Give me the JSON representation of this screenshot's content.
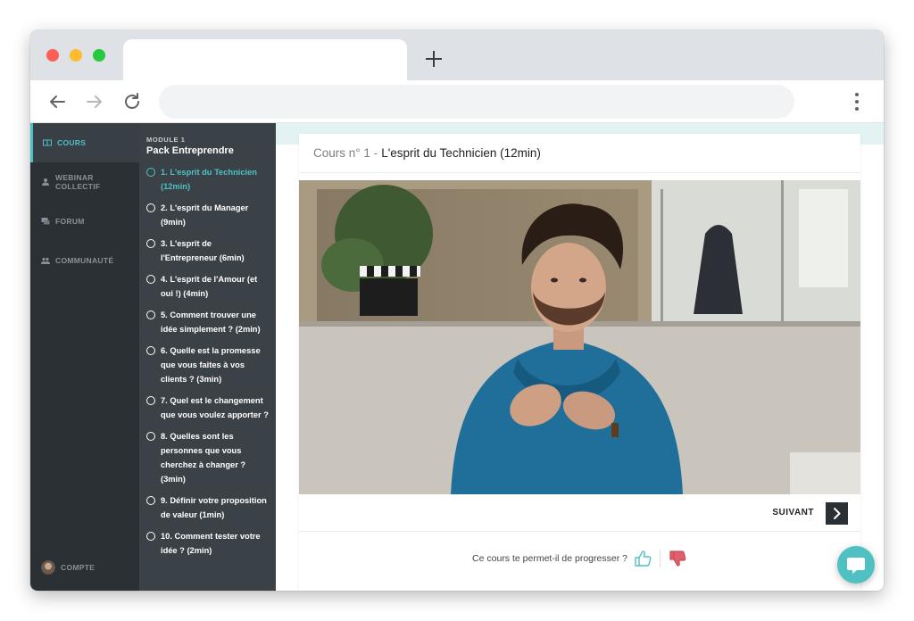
{
  "browser": {
    "tab_title": "",
    "address": ""
  },
  "sidebar": {
    "items": [
      {
        "label": "COURS",
        "icon": "book-icon",
        "active": true
      },
      {
        "label": "WEBINAR COLLECTIF",
        "icon": "person-icon",
        "active": false
      },
      {
        "label": "FORUM",
        "icon": "chat-icon",
        "active": false
      },
      {
        "label": "COMMUNAUTÉ",
        "icon": "people-icon",
        "active": false
      }
    ],
    "account_label": "COMPTE"
  },
  "courselist": {
    "module_label": "MODULE 1",
    "module_title": "Pack Entreprendre",
    "lessons": [
      "1. L'esprit du Technicien (12min)",
      "2. L'esprit du Manager (9min)",
      "3. L'esprit de l'Entrepreneur (6min)",
      "4. L'esprit de l'Amour (et oui !) (4min)",
      "5. Comment trouver une idée simplement ? (2min)",
      "6. Quelle est la promesse que vous faites à vos clients ? (3min)",
      "7. Quel est le changement que vous voulez apporter ?",
      "8. Quelles sont les personnes que vous cherchez à changer ? (3min)",
      "9. Définir votre proposition de valeur (1min)",
      "10. Comment tester votre idée ? (2min)"
    ],
    "active_index": 0
  },
  "main": {
    "course_prefix": "Cours n° 1 -",
    "course_title": "L'esprit du Technicien (12min)",
    "next_label": "SUIVANT",
    "feedback_question": "Ce cours te permet-il de progresser ?"
  },
  "colors": {
    "accent": "#4fc1c3",
    "sidebar_bg": "#2b3034",
    "courselist_bg": "#3b4247",
    "thumb_up": "#4fc1c3",
    "thumb_down": "#e0606b"
  }
}
